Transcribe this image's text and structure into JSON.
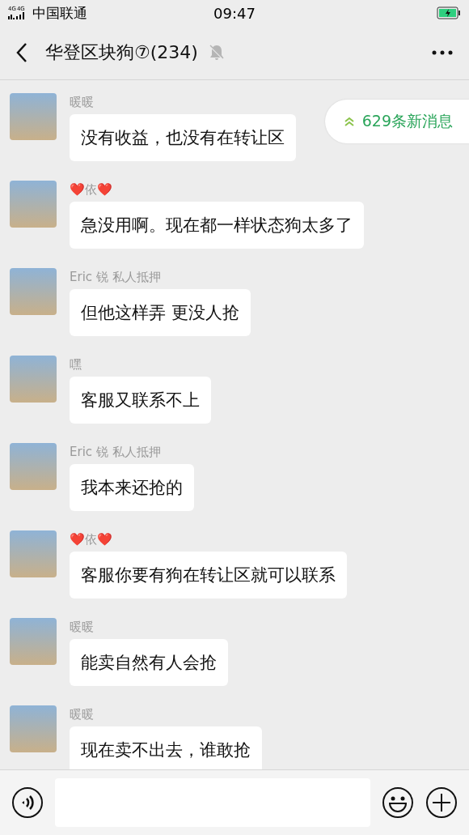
{
  "status_bar": {
    "network_labels": [
      "4G",
      "4G"
    ],
    "carrier": "中国联通",
    "time": "09:47"
  },
  "header": {
    "title": "华登区块狗⑦(234)",
    "muted": true
  },
  "new_messages_pill": {
    "text": "629条新消息"
  },
  "messages": [
    {
      "sender": "暖暖",
      "text": "没有收益，也没有在转让区"
    },
    {
      "sender": "❤️依❤️",
      "text": "急没用啊。现在都一样状态狗太多了"
    },
    {
      "sender": "Eric 锐 私人抵押",
      "text": "但他这样弄 更没人抢"
    },
    {
      "sender": "嘿",
      "text": "客服又联系不上"
    },
    {
      "sender": "Eric 锐 私人抵押",
      "text": "我本来还抢的"
    },
    {
      "sender": "❤️依❤️",
      "text": "客服你要有狗在转让区就可以联系"
    },
    {
      "sender": "暖暖",
      "text": "能卖自然有人会抢"
    },
    {
      "sender": "暖暖",
      "text": "现在卖不出去，谁敢抢"
    }
  ]
}
